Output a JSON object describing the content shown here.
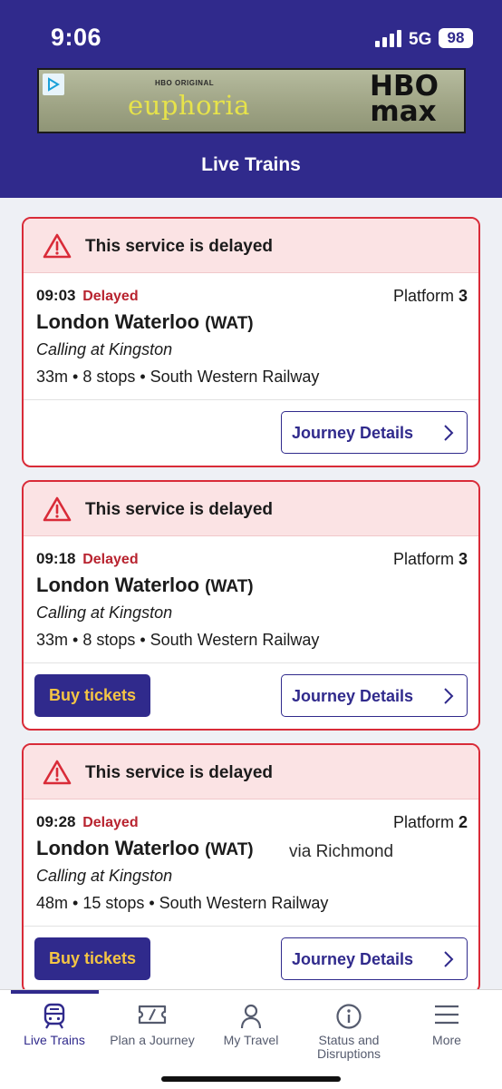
{
  "status_bar": {
    "time": "9:06",
    "network": "5G",
    "battery": "98"
  },
  "ad": {
    "small_text": "HBO ORIGINAL",
    "show_title": "euphoria",
    "logo_line1": "HBO",
    "logo_line2": "max"
  },
  "header": {
    "title": "Live Trains"
  },
  "services": [
    {
      "banner": "This service is delayed",
      "time": "09:03",
      "status": "Delayed",
      "platform_label": "Platform",
      "platform_number": "3",
      "destination": "London Waterloo",
      "code": "(WAT)",
      "via": "",
      "calling": "Calling at Kingston",
      "summary": "33m • 8 stops • South Western Railway",
      "buy_label": "",
      "details_label": "Journey Details"
    },
    {
      "banner": "This service is delayed",
      "time": "09:18",
      "status": "Delayed",
      "platform_label": "Platform",
      "platform_number": "3",
      "destination": "London Waterloo",
      "code": "(WAT)",
      "via": "",
      "calling": "Calling at Kingston",
      "summary": "33m • 8 stops • South Western Railway",
      "buy_label": "Buy tickets",
      "details_label": "Journey Details"
    },
    {
      "banner": "This service is delayed",
      "time": "09:28",
      "status": "Delayed",
      "platform_label": "Platform",
      "platform_number": "2",
      "destination": "London Waterloo",
      "code": "(WAT)",
      "via": "via Richmond",
      "calling": "Calling at Kingston",
      "summary": "48m • 15 stops • South Western Railway",
      "buy_label": "Buy tickets",
      "details_label": "Journey Details"
    }
  ],
  "tabs": [
    {
      "label": "Live Trains",
      "icon": "train-icon",
      "active": true
    },
    {
      "label": "Plan a Journey",
      "icon": "ticket-icon",
      "active": false
    },
    {
      "label": "My Travel",
      "icon": "person-icon",
      "active": false
    },
    {
      "label": "Status and Disruptions",
      "icon": "info-icon",
      "active": false
    },
    {
      "label": "More",
      "icon": "menu-icon",
      "active": false
    }
  ],
  "colors": {
    "brand": "#302a8c",
    "alert_border": "#d92b38",
    "alert_background": "#fbe3e4",
    "delayed_text": "#b8232f",
    "buy_button_text": "#f5c544"
  }
}
